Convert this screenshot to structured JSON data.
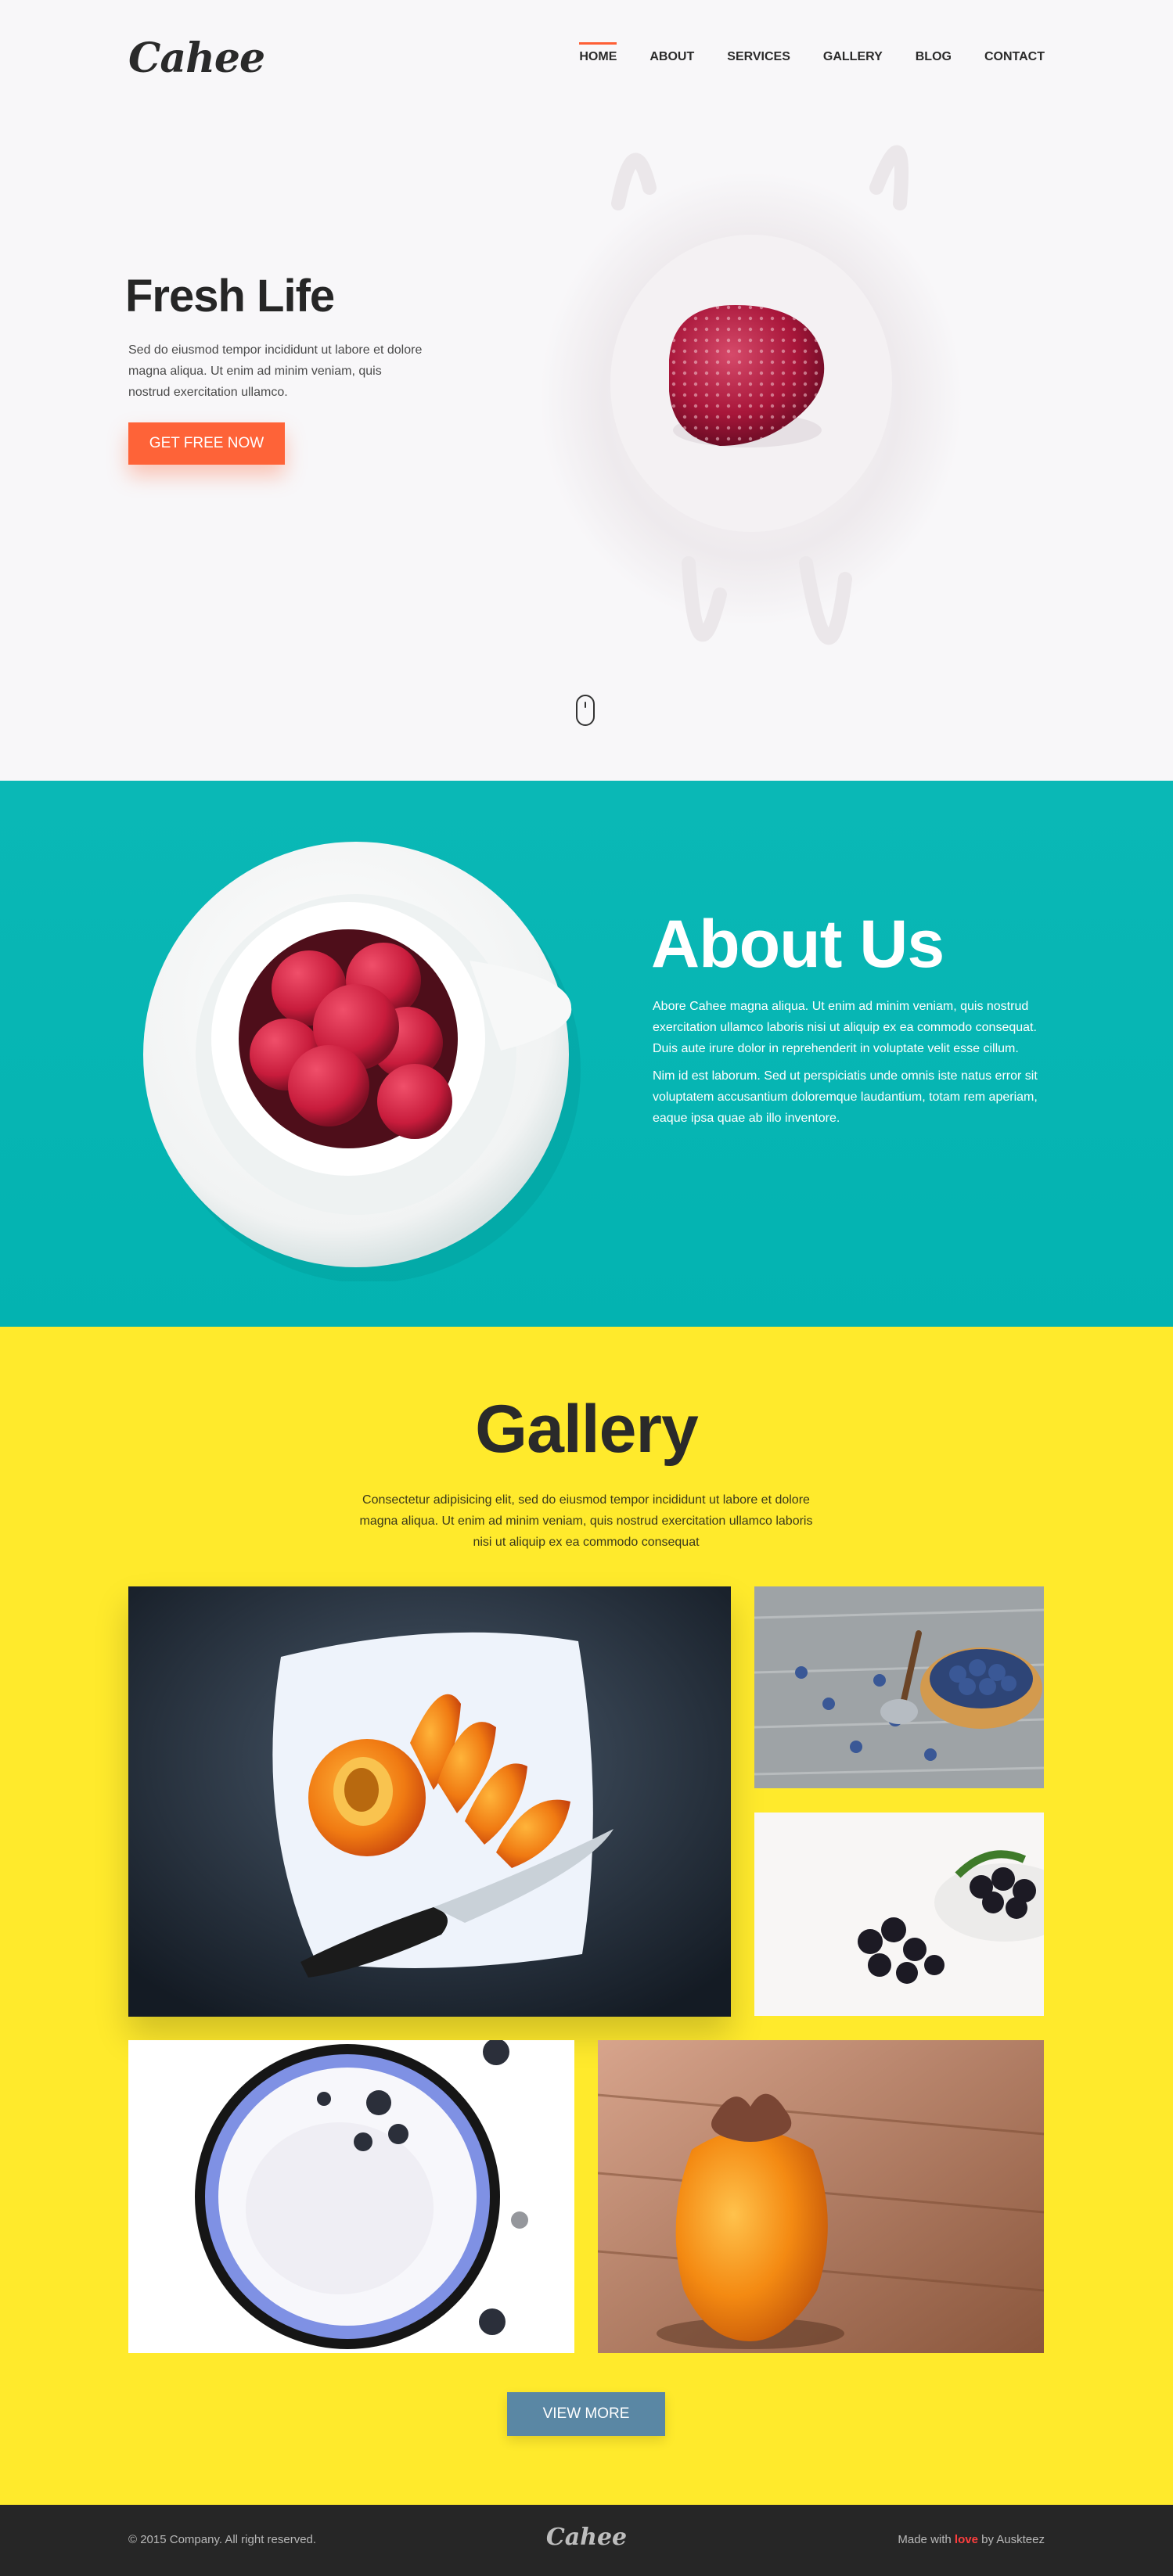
{
  "brand": {
    "logo": "Cahee"
  },
  "nav": {
    "items": [
      {
        "label": "HOME",
        "active": true
      },
      {
        "label": "ABOUT",
        "active": false
      },
      {
        "label": "SERVICES",
        "active": false
      },
      {
        "label": "GALLERY",
        "active": false
      },
      {
        "label": "BLOG",
        "active": false
      },
      {
        "label": "CONTACT",
        "active": false
      }
    ]
  },
  "hero": {
    "title": "Fresh Life",
    "text": "Sed do eiusmod tempor incididunt ut labore et dolore magna aliqua. Ut enim ad minim veniam, quis nostrud exercitation ullamco.",
    "button": "GET FREE NOW"
  },
  "about": {
    "title": "About Us",
    "paragraph1": "Abore Cahee magna aliqua. Ut enim ad minim veniam, quis nostrud exercitation ullamco laboris nisi ut aliquip ex ea commodo consequat. Duis aute irure dolor in reprehenderit in voluptate velit esse cillum.",
    "paragraph2": "Nim id est laborum. Sed ut perspiciatis unde omnis iste natus error sit voluptatem accusantium doloremque laudantium, totam rem aperiam, eaque ipsa quae ab illo inventore."
  },
  "gallery": {
    "title": "Gallery",
    "text": "Consectetur adipisicing elit, sed do eiusmod tempor incididunt ut labore et dolore magna aliqua. Ut enim ad minim veniam, quis nostrud exercitation ullamco laboris nisi ut aliquip ex ea commodo consequat",
    "button": "VIEW MORE"
  },
  "footer": {
    "copyright": "© 2015 Company. All right reserved.",
    "logo": "Cahee",
    "made_prefix": "Made with",
    "made_love": "love",
    "made_suffix": "by Auskteez"
  },
  "colors": {
    "accent": "#fe6338",
    "teal": "#03b3b1",
    "yellow": "#ffea2c",
    "button_blue": "#5a87a4",
    "footer_bg": "#262626"
  }
}
